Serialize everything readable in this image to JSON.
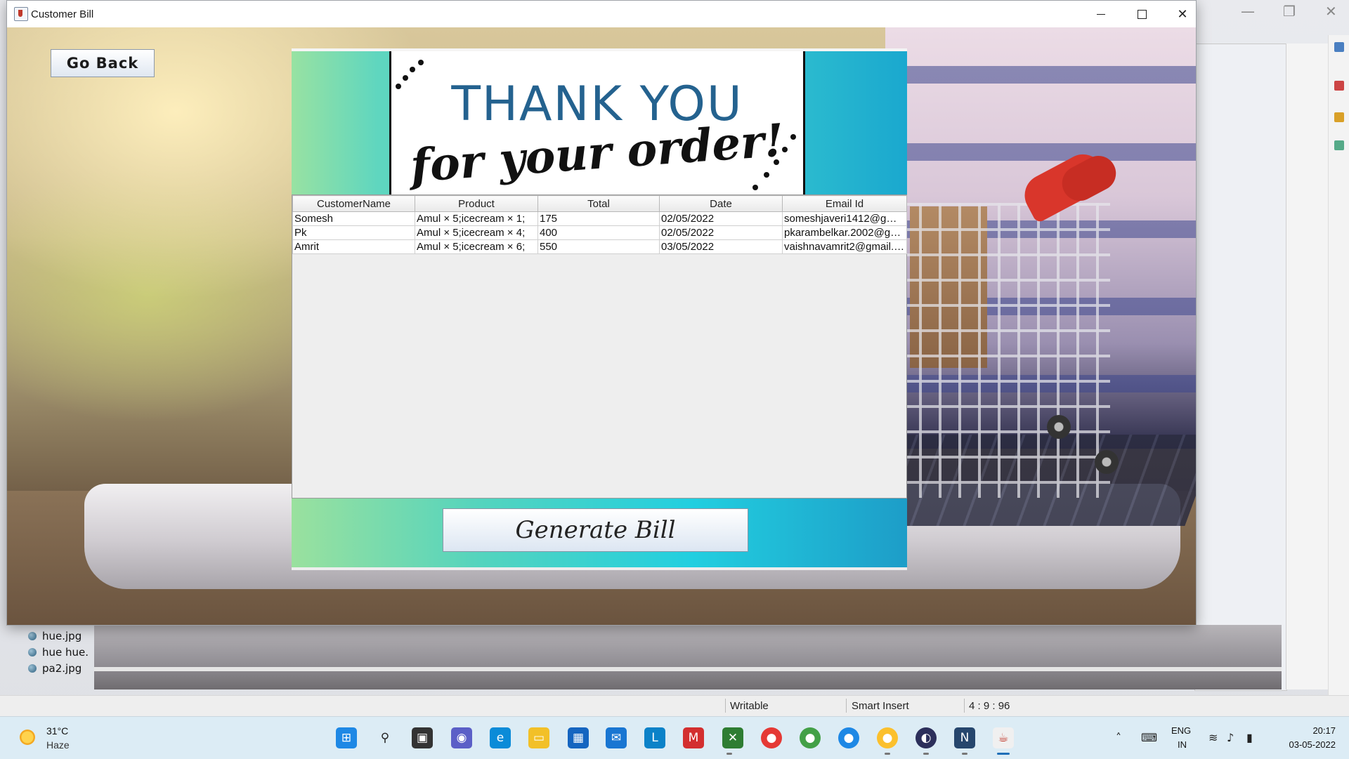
{
  "window": {
    "title": "Customer Bill",
    "min_glyph": "",
    "close_glyph": "✕"
  },
  "nav": {
    "go_back_label": "Go Back"
  },
  "banner": {
    "line1": "THANK YOU",
    "line2": "for your order!"
  },
  "table": {
    "columns": [
      "CustomerName",
      "Product",
      "Total",
      "Date",
      "Email Id"
    ],
    "rows": [
      [
        "Somesh",
        "Amul × 5;icecream × 1;",
        "175",
        "02/05/2022",
        "someshjaveri1412@gmai..."
      ],
      [
        "Pk",
        "Amul × 5;icecream × 4;",
        "400",
        "02/05/2022",
        "pkarambelkar.2002@gm..."
      ],
      [
        "Amrit",
        "Amul × 5;icecream × 6;",
        "550",
        "03/05/2022",
        "vaishnavamrit2@gmail.c..."
      ]
    ]
  },
  "actions": {
    "generate_label": "Generate Bill"
  },
  "background_ide": {
    "files": [
      "hue.jpg",
      "hue hue.",
      "pa2.jpg"
    ],
    "status": {
      "writable": "Writable",
      "insert_mode": "Smart Insert",
      "position": "4 : 9 : 96"
    }
  },
  "taskbar": {
    "weather_temp": "31°C",
    "weather_cond": "Haze",
    "lang_top": "ENG",
    "lang_bottom": "IN",
    "time": "20:17",
    "date": "03-05-2022"
  },
  "colors": {
    "banner_left": "#98e2a2",
    "banner_right": "#1aa8cf",
    "thank_you_text": "#24628f"
  }
}
